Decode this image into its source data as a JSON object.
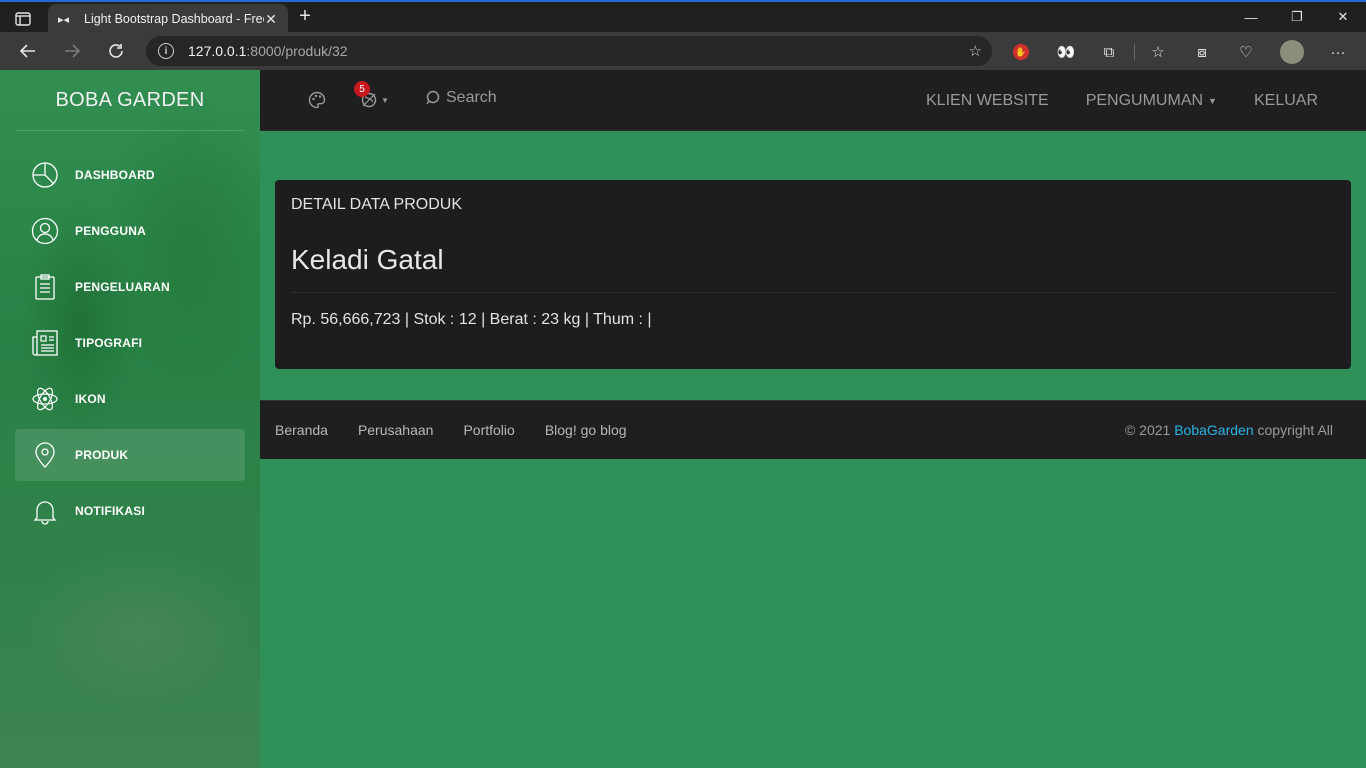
{
  "browser": {
    "tab_title": "Light Bootstrap Dashboard - Free",
    "url_host": "127.0.0.1",
    "url_path": ":8000/produk/32",
    "window_controls": [
      "minimize",
      "restore",
      "close"
    ]
  },
  "sidebar": {
    "brand": "BOBA GARDEN",
    "items": [
      {
        "label": "DASHBOARD",
        "icon": "pie-chart-icon"
      },
      {
        "label": "PENGGUNA",
        "icon": "user-icon"
      },
      {
        "label": "PENGELUARAN",
        "icon": "clipboard-icon"
      },
      {
        "label": "TIPOGRAFI",
        "icon": "news-icon"
      },
      {
        "label": "IKON",
        "icon": "atom-icon"
      },
      {
        "label": "PRODUK",
        "icon": "map-pin-icon",
        "active": true
      },
      {
        "label": "NOTIFIKASI",
        "icon": "bell-icon"
      }
    ]
  },
  "topnav": {
    "notification_count": "5",
    "search_label": "Search",
    "links": {
      "klien": "KLIEN WEBSITE",
      "pengumuman": "PENGUMUMAN",
      "keluar": "KELUAR"
    }
  },
  "card": {
    "title": "DETAIL DATA PRODUK",
    "product_name": "Keladi Gatal",
    "product_info": "Rp. 56,666,723 | Stok : 12 | Berat : 23 kg | Thum : |"
  },
  "footer": {
    "links": [
      "Beranda",
      "Perusahaan",
      "Portfolio",
      "Blog! go blog"
    ],
    "copyright_prefix": "© 2021",
    "copyright_brand": "BobaGarden",
    "copyright_suffix": "copyright All"
  },
  "colors": {
    "content_bg": "#2f9158",
    "navbar_bg": "#1f1f22",
    "card_bg": "#1d1d20",
    "badge": "#c9181e",
    "link_accent": "#26b3e4"
  }
}
